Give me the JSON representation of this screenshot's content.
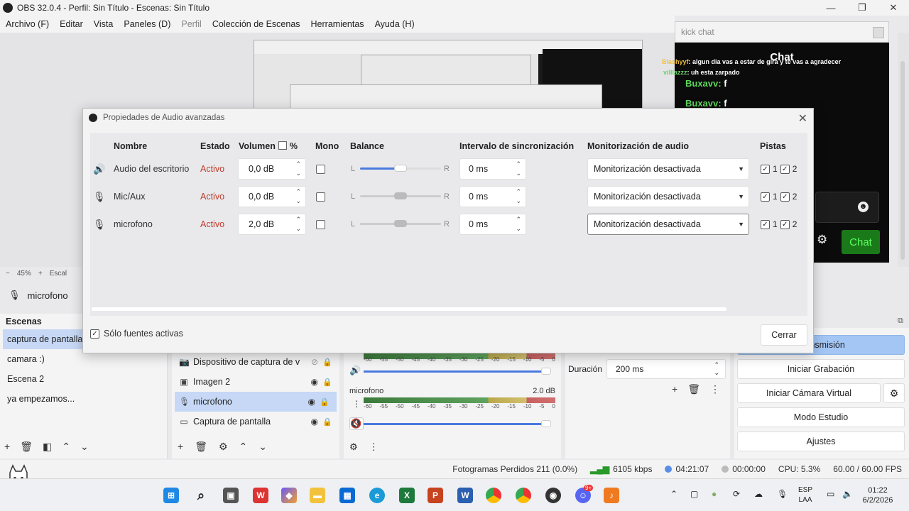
{
  "window": {
    "title": "OBS 32.0.4 - Perfil: Sin Título - Escenas: Sin Título",
    "controls": [
      "—",
      "❐",
      "✕"
    ]
  },
  "menu": [
    "Archivo (F)",
    "Editar",
    "Vista",
    "Paneles (D)",
    "Perfil",
    "Colección de Escenas",
    "Herramientas",
    "Ayuda (H)"
  ],
  "kick_chat": {
    "input_placeholder": "kick chat",
    "header": "Chat",
    "lines": [
      {
        "user": "Blashyyf",
        "text": ": algun dia vas a estar de gira y te vas a agradecer"
      },
      {
        "user": "villlazzz",
        "text": ": uh esta zarpado"
      }
    ],
    "big_lines": [
      {
        "user": "Buxavv:",
        "text": " f"
      },
      {
        "user": "Buxavv:",
        "text": " f"
      }
    ],
    "send_button": "Chat"
  },
  "preview": {
    "zoom": "45%",
    "scale_label": "Escal"
  },
  "source_bar": {
    "current_source": "microfono"
  },
  "scenes": {
    "title": "Escenas",
    "items": [
      "captura de pantalla",
      "camara :)",
      "Escena 2",
      "ya empezamos..."
    ],
    "selected": 0
  },
  "sources": {
    "items": [
      {
        "name": "Dispositivo de captura de v",
        "icon": "camera",
        "visible": false
      },
      {
        "name": "Imagen 2",
        "icon": "image",
        "visible": true
      },
      {
        "name": "microfono",
        "icon": "mic",
        "visible": true
      },
      {
        "name": "Captura de pantalla",
        "icon": "monitor",
        "visible": true
      }
    ],
    "selected": 2
  },
  "mixer": {
    "ticks": [
      "-60",
      "-55",
      "-50",
      "-45",
      "-40",
      "-35",
      "-30",
      "-25",
      "-20",
      "-15",
      "-10",
      "-5",
      "0"
    ],
    "channel2_label": "microfono",
    "channel2_db": "2.0 dB"
  },
  "transitions": {
    "duration_label": "Duración",
    "duration_value": "200 ms"
  },
  "controls": {
    "buttons": [
      "Transmisión",
      "Iniciar Grabación",
      "Iniciar Cámara Virtual",
      "Modo Estudio",
      "Ajustes"
    ]
  },
  "status": {
    "dropped": "Fotogramas Perdidos 211 (0.0%)",
    "bitrate": "6105 kbps",
    "stream_time": "04:21:07",
    "rec_time": "00:00:00",
    "cpu": "CPU: 5.3%",
    "fps": "60.00 / 60.00 FPS"
  },
  "taskbar": {
    "lang1": "ESP",
    "lang2": "LAA",
    "time": "01:22",
    "date": "6/2/2026",
    "discord_badge": "9+"
  },
  "dialog": {
    "title": "Propiedades de Audio avanzadas",
    "headers": {
      "name": "Nombre",
      "state": "Estado",
      "volume": "Volumen",
      "percent": "%",
      "mono": "Mono",
      "balance": "Balance",
      "sync": "Intervalo de sincronización",
      "monitoring": "Monitorización de audio",
      "tracks": "Pistas"
    },
    "rows": [
      {
        "name": "Audio del escritorio",
        "state": "Activo",
        "volume": "0,0 dB",
        "balance_left": "L",
        "balance_right": "R",
        "balance": 0.5,
        "sync": "0 ms",
        "monitoring": "Monitorización desactivada",
        "track1": "1",
        "track2": "2"
      },
      {
        "name": "Mic/Aux",
        "state": "Activo",
        "volume": "0,0 dB",
        "balance_left": "L",
        "balance_right": "R",
        "balance": 0.5,
        "sync": "0 ms",
        "monitoring": "Monitorización desactivada",
        "track1": "1",
        "track2": "2"
      },
      {
        "name": "microfono",
        "state": "Activo",
        "volume": "2,0 dB",
        "balance_left": "L",
        "balance_right": "R",
        "balance": 0.5,
        "sync": "0 ms",
        "monitoring": "Monitorización desactivada",
        "track1": "1",
        "track2": "2"
      }
    ],
    "only_active_label": "Sólo fuentes activas",
    "close_label": "Cerrar"
  }
}
